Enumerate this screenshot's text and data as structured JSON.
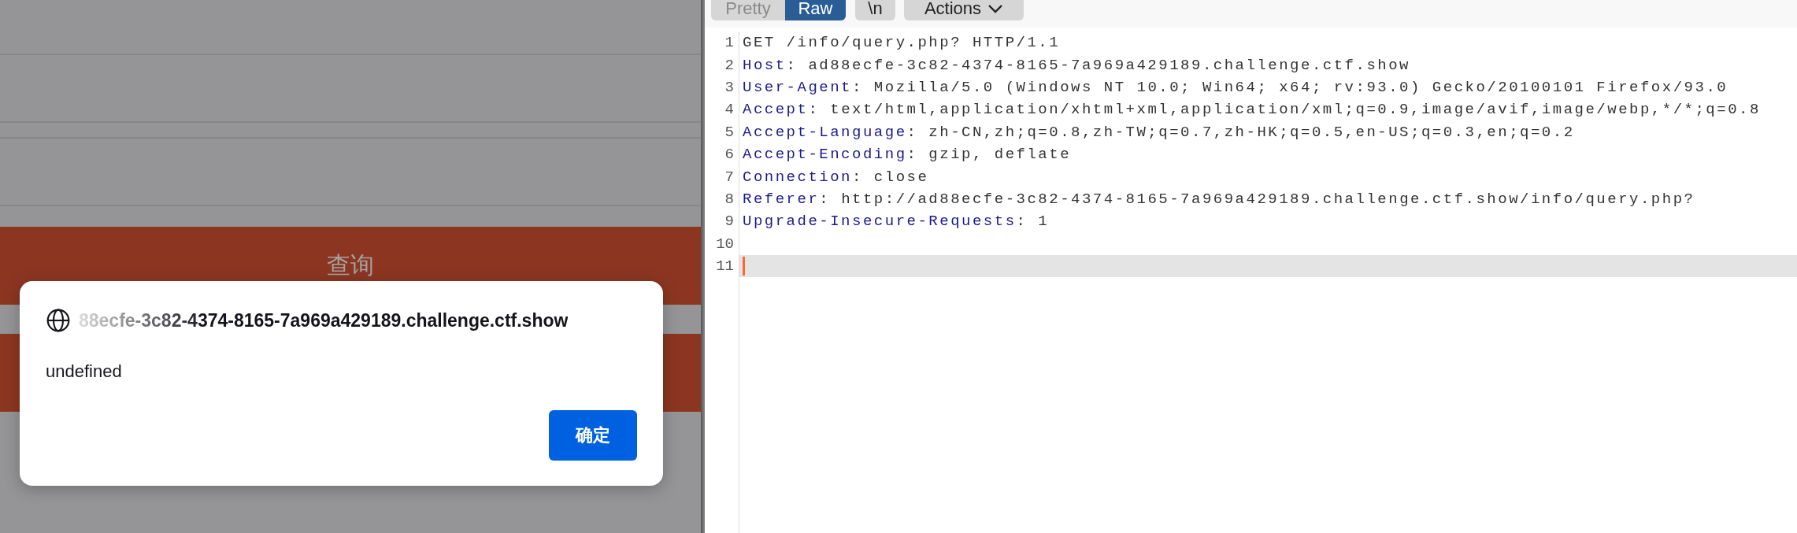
{
  "page": {
    "query_button": "查询"
  },
  "alert": {
    "origin": "88ecfe-3c82-4374-8165-7a969a429189.challenge.ctf.show",
    "message": "undefined",
    "ok_button": "确定"
  },
  "editor": {
    "tabs": [
      {
        "label": "Pretty",
        "selected": false
      },
      {
        "label": "Raw",
        "selected": true
      }
    ],
    "newline_button": "\\n",
    "actions_button": "Actions",
    "lines": [
      {
        "number": "1",
        "value": "GET /info/query.php? HTTP/1.1",
        "current": false
      },
      {
        "number": "2",
        "name": "Host",
        "value": ": ad88ecfe-3c82-4374-8165-7a969a429189.challenge.ctf.show",
        "current": false
      },
      {
        "number": "3",
        "name": "User-Agent",
        "value": ": Mozilla/5.0 (Windows NT 10.0; Win64; x64; rv:93.0) Gecko/20100101 Firefox/93.0",
        "current": false
      },
      {
        "number": "4",
        "name": "Accept",
        "value": ": text/html,application/xhtml+xml,application/xml;q=0.9,image/avif,image/webp,*/*;q=0.8",
        "current": false
      },
      {
        "number": "5",
        "name": "Accept-Language",
        "value": ": zh-CN,zh;q=0.8,zh-TW;q=0.7,zh-HK;q=0.5,en-US;q=0.3,en;q=0.2",
        "current": false
      },
      {
        "number": "6",
        "name": "Accept-Encoding",
        "value": ": gzip, deflate",
        "current": false
      },
      {
        "number": "7",
        "name": "Connection",
        "value": ": close",
        "current": false
      },
      {
        "number": "8",
        "name": "Referer",
        "value": ": http://ad88ecfe-3c82-4374-8165-7a969a429189.challenge.ctf.show/info/query.php?",
        "current": false
      },
      {
        "number": "9",
        "name": "Upgrade-Insecure-Requests",
        "value": ": 1",
        "current": false
      },
      {
        "number": "10",
        "current": false
      },
      {
        "number": "11",
        "current": true
      }
    ]
  }
}
